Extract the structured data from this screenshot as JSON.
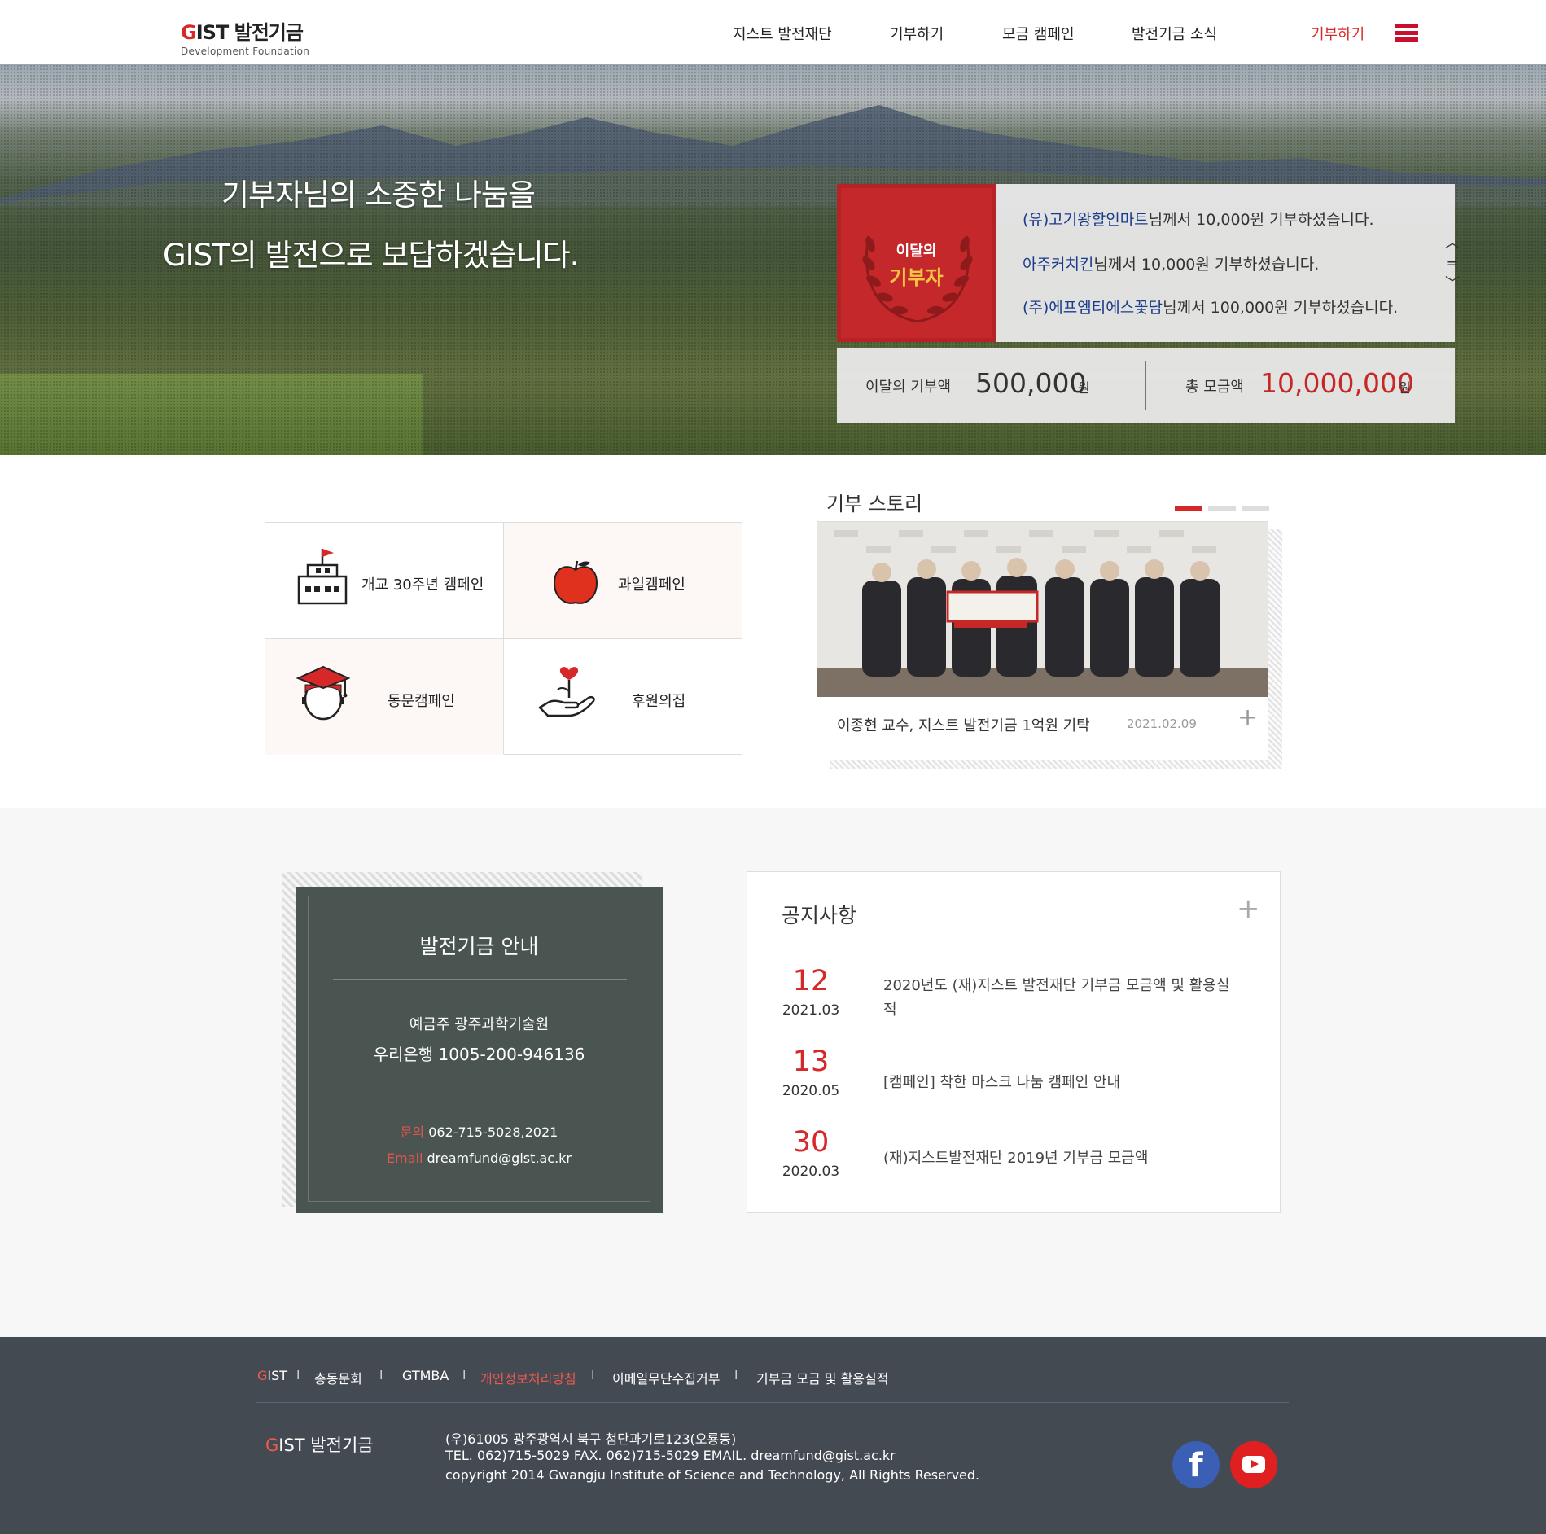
{
  "header": {
    "logo_main_red": "G",
    "logo_main_rest": "IST 발전기금",
    "logo_sub": "Development Foundation",
    "nav": [
      "지스트 발전재단",
      "기부하기",
      "모금 캠페인",
      "발전기금 소식"
    ],
    "donate_link": "기부하기",
    "menu_icon": "hamburger-menu-icon"
  },
  "hero": {
    "title_line1": "기부자님의 소중한 나눔을",
    "title_line2": "GIST의 발전으로 보답하겠습니다.",
    "badge_line1": "이달의",
    "badge_line2": "기부자",
    "donors": [
      {
        "name": "(유)고기왕할인마트",
        "suffix": "님께서 10,000원 기부하셨습니다."
      },
      {
        "name": "아주커치킨",
        "suffix": "님께서 10,000원 기부하셨습니다."
      },
      {
        "name": "(주)에프엠티에스꽃담",
        "suffix": "님께서 100,000원 기부하셨습니다."
      }
    ],
    "arrows": {
      "up": "︿",
      "pause": "=",
      "down": "﹀"
    },
    "monthly_label": "이달의 기부액",
    "monthly_value": "500,000",
    "monthly_unit": "원",
    "total_label": "총 모금액",
    "total_value": "10,000,000",
    "total_unit": "원",
    "colors": {
      "badge": "#c5282b",
      "donor_name": "#1a3a8a",
      "total": "#c62828"
    }
  },
  "campaigns": [
    {
      "label": "개교 30주년 캠페인",
      "icon": "school-building-icon"
    },
    {
      "label": "과일캠페인",
      "icon": "apple-icon"
    },
    {
      "label": "동문캠페인",
      "icon": "graduate-cap-icon"
    },
    {
      "label": "후원의집",
      "icon": "hand-heart-sprout-icon"
    }
  ],
  "story": {
    "title": "기부 스토리",
    "slides": 3,
    "active_slide": 1,
    "caption": "이종현 교수, 지스트 발전기금 1억원 기탁",
    "date": "2021.02.09",
    "plus": "+"
  },
  "fund_info": {
    "title": "발전기금 안내",
    "holder": "예금주 광주과학기술원",
    "bank": "우리은행  1005-200-946136",
    "phone_label": "문의",
    "phone": "062-715-5028,2021",
    "email_label": "Email",
    "email": "dreamfund@gist.ac.kr"
  },
  "notices": {
    "title": "공지사항",
    "plus": "+",
    "items": [
      {
        "day": "12",
        "ym": "2021.03",
        "text": "2020년도 (재)지스트 발전재단  기부금 모금액 및 활용실적"
      },
      {
        "day": "13",
        "ym": "2020.05",
        "text": "[캠페인] 착한 마스크 나눔 캠페인 안내"
      },
      {
        "day": "30",
        "ym": "2020.03",
        "text": "(재)지스트발전재단 2019년 기부금 모금액"
      }
    ]
  },
  "footer": {
    "links": [
      {
        "red": "G",
        "rest": "IST"
      },
      {
        "text": "총동문회"
      },
      {
        "text": "GTMBA"
      },
      {
        "text": "개인정보처리방침"
      },
      {
        "text": "이메일무단수집거부"
      },
      {
        "text": "기부금 모금 및 활용실적"
      }
    ],
    "separator": "I",
    "brand_red": "G",
    "brand_rest": "IST 발전기금",
    "address": "(우)61005 광주광역시 북구 첨단과기로123(오룡동)",
    "contact": "TEL. 062)715-5029    FAX. 062)715-5029    EMAIL. dreamfund@gist.ac.kr",
    "copyright": "copyright 2014 Gwangju Institute of Science and Technology, All Rights Reserved.",
    "social": [
      "facebook-icon",
      "youtube-icon"
    ],
    "facebook_glyph": "f"
  }
}
